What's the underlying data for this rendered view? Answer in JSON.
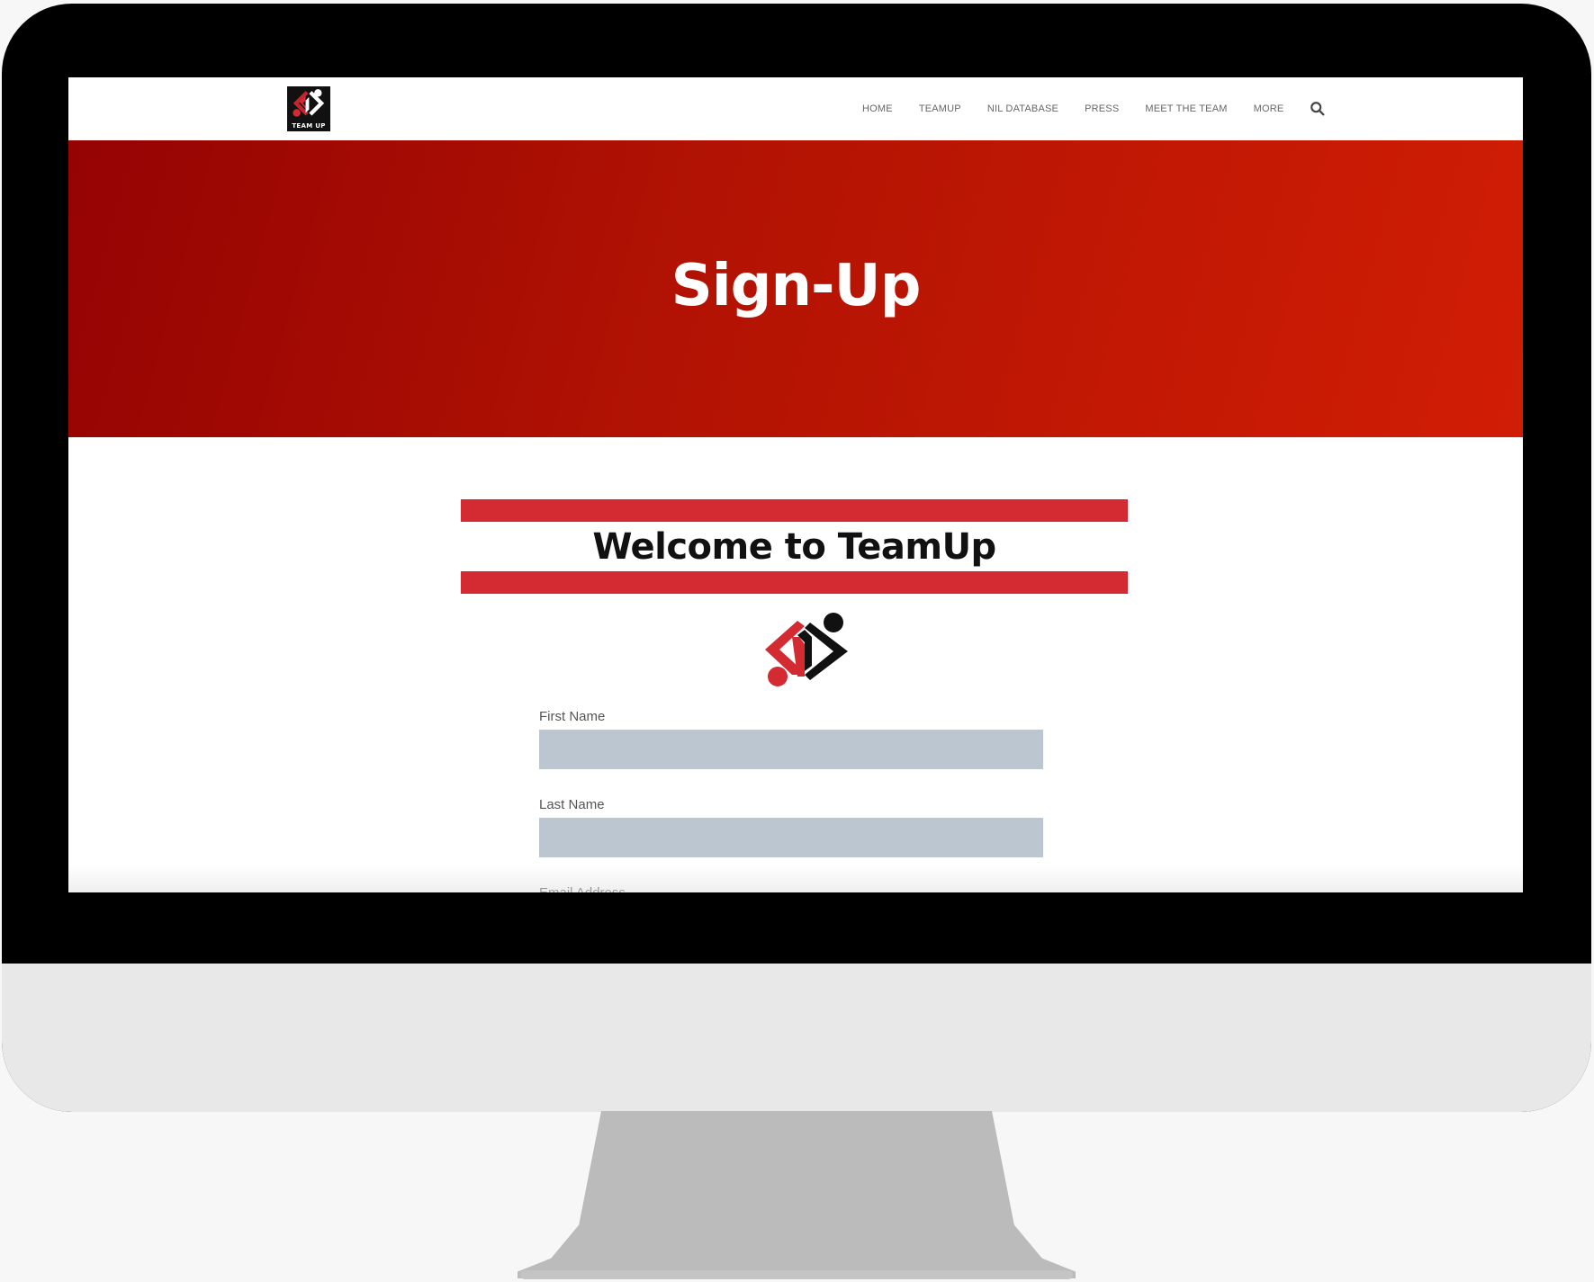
{
  "header": {
    "logo_text": "TEAM UP",
    "nav": [
      {
        "label": "HOME"
      },
      {
        "label": "TEAMUP"
      },
      {
        "label": "NIL DATABASE"
      },
      {
        "label": "PRESS"
      },
      {
        "label": "MEET THE TEAM"
      },
      {
        "label": "MORE"
      }
    ],
    "search_icon": "search-icon"
  },
  "hero": {
    "title": "Sign-Up"
  },
  "banner": {
    "text": "Welcome to TeamUp",
    "stripe_color": "#d42a31"
  },
  "form": {
    "first_name_label": "First Name",
    "first_name_value": "",
    "last_name_label": "Last Name",
    "last_name_value": "",
    "email_label": "Email Address"
  },
  "colors": {
    "hero_start": "#950303",
    "hero_end": "#d11d05",
    "input_bg": "#bcc6d0",
    "brand_red": "#d42a31"
  }
}
